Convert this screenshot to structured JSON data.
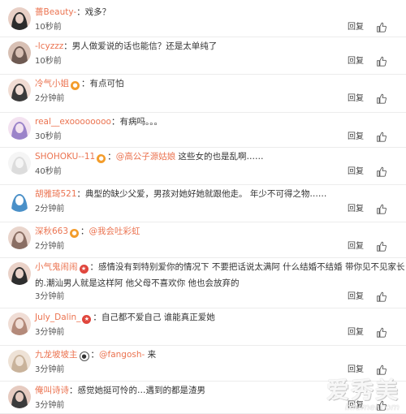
{
  "comments": [
    {
      "user": "薔Beauty-",
      "text": "：戏多？",
      "time": "10秒前",
      "reply": "回复",
      "badge": "",
      "avatar": [
        "#2b2b2b",
        "#e8cfc5"
      ]
    },
    {
      "user": "-lcyzzz",
      "text": "：男人做爱说的话也能信？还是太单纯了",
      "time": "10秒前",
      "reply": "回复",
      "badge": "",
      "avatar": [
        "#6e5a52",
        "#d8c0b4"
      ]
    },
    {
      "user": "冷气小姐",
      "text": "：有点可怕",
      "time": "2分钟前",
      "reply": "回复",
      "badge": "icon",
      "avatar": [
        "#3a3a3a",
        "#f1dcd3"
      ]
    },
    {
      "user": "real__exoooooooo",
      "text": "：有病吗。。。",
      "time": "30秒前",
      "reply": "回复",
      "badge": "",
      "avatar": [
        "#9b83c9",
        "#f3e2f0"
      ]
    },
    {
      "user": "SHOHOKU--11",
      "text": "：",
      "mention": "@高公子源姑娘",
      "text2": " 这些女的也是乱啊……",
      "time": "40秒前",
      "reply": "回复",
      "badge": "icon",
      "avatar": [
        "#dcdcdc",
        "#f5f5f5"
      ]
    },
    {
      "user": "胡雅琦521",
      "text": "：典型的缺少父爱，男孩对她好她就跟他走。 年少不可得之物……",
      "time": "2分钟前",
      "reply": "回复",
      "badge": "",
      "avatar": [
        "#4a90c8",
        "#ffffff"
      ]
    },
    {
      "user": "深秋663",
      "text": "：",
      "mention": "@我会吐彩虹",
      "text2": "",
      "time": "2分钟前",
      "reply": "回复",
      "badge": "icon",
      "avatar": [
        "#8a6e63",
        "#e9d5cc"
      ]
    },
    {
      "user": "小气鬼闹闹",
      "text": "：感情没有到特别爱你的情况下 不要把话说太满阿 什么结婚不结婚 带你见不见家长",
      "text_line2": "的.潮汕男人就是这样阿 他父母不喜欢你 他也会放弃的",
      "time": "3分钟前",
      "reply": "回复",
      "badge": "star",
      "avatar": [
        "#2e2e2e",
        "#ead2c8"
      ]
    },
    {
      "user": "July_Dalin_",
      "text": "：自己都不爱自己 谁能真正爱她",
      "time": "3分钟前",
      "reply": "回复",
      "badge": "star",
      "avatar": [
        "#b48a7a",
        "#f0ddd5"
      ]
    },
    {
      "user": "九龙坡坡主",
      "text": "：",
      "mention": "@fangosh-",
      "text2": " 来",
      "time": "3分钟前",
      "reply": "回复",
      "badge": "panda",
      "avatar": [
        "#c9b39b",
        "#eee2d6"
      ]
    },
    {
      "user": "俺叫诗诗",
      "text": "：感觉她挺可怜的…遇到的都是渣男",
      "time": "3分钟前",
      "reply": "回复",
      "badge": "",
      "avatar": [
        "#3b3b3b",
        "#e6cbc0"
      ]
    }
  ],
  "watermark": {
    "main": "爱秀美",
    "sub": "ixiumei.com"
  },
  "colors": {
    "username": "#eb7350",
    "text": "#333333",
    "separator": "#ececec"
  }
}
